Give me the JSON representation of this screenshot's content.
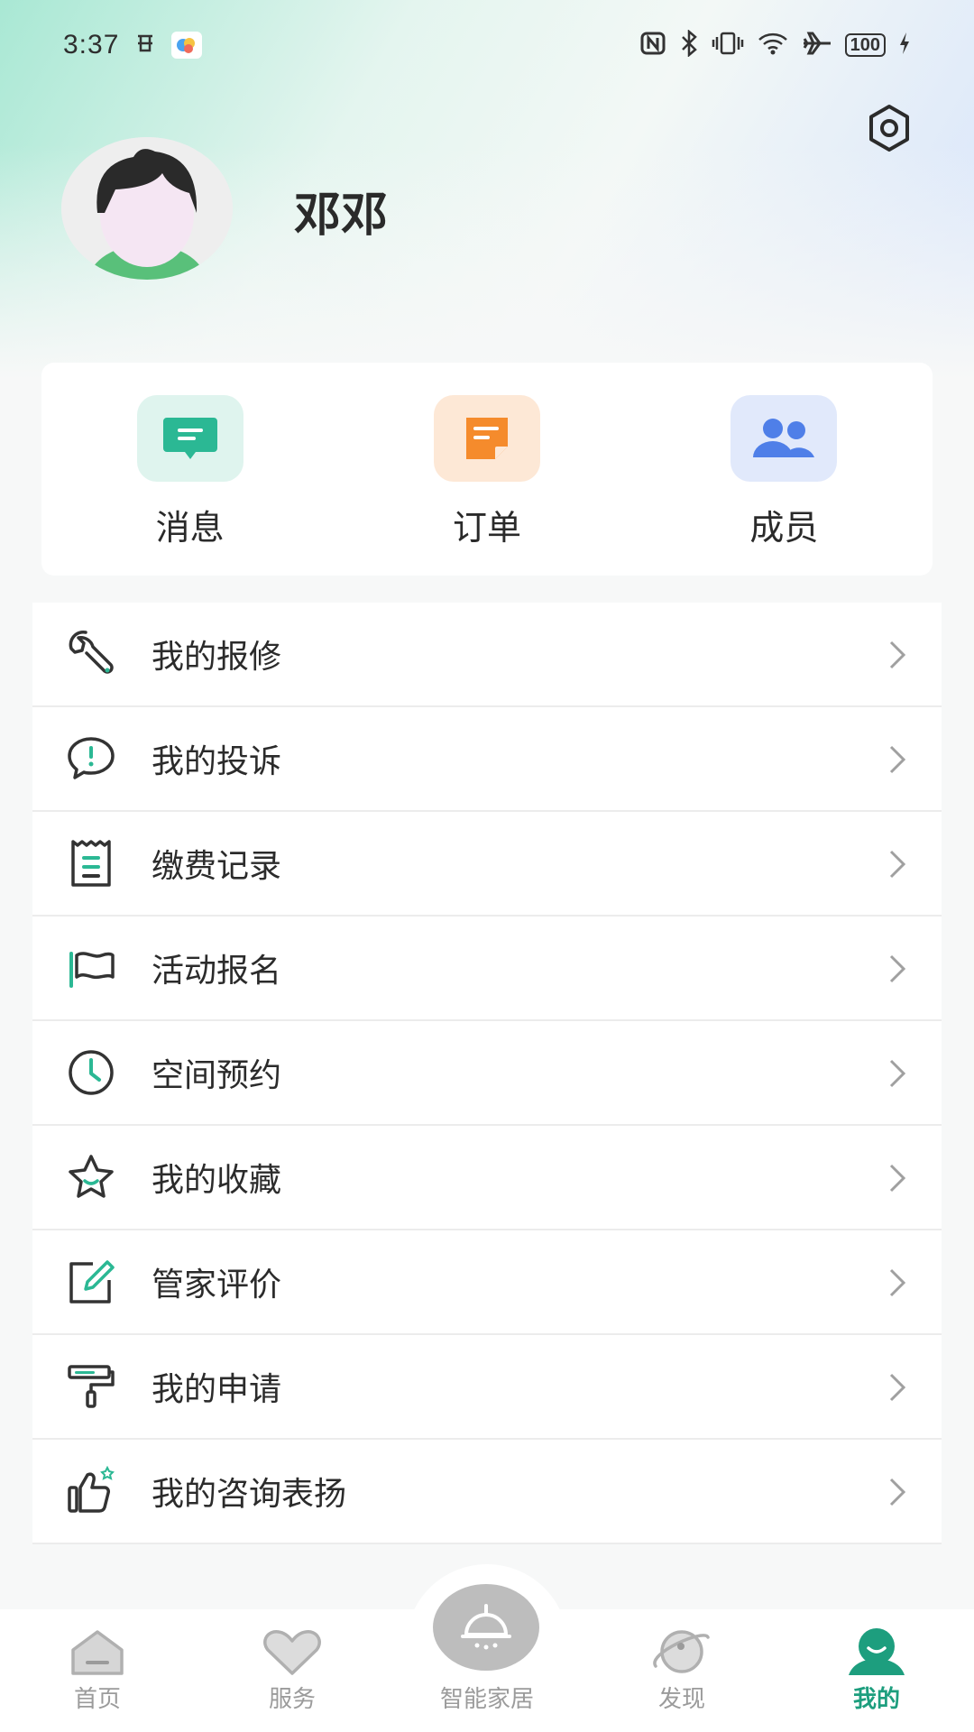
{
  "status_bar": {
    "time": "3:37",
    "battery": "100",
    "icons": [
      "nfc-icon",
      "bluetooth-icon",
      "vibrate-icon",
      "wifi-icon",
      "airplane-icon",
      "battery-icon",
      "charging-icon"
    ]
  },
  "profile": {
    "name": "邓邓",
    "settings_icon": "gear-icon"
  },
  "quick_actions": [
    {
      "label": "消息",
      "icon": "message-icon",
      "color": "#2bb894",
      "bg": "#dff4ee"
    },
    {
      "label": "订单",
      "icon": "order-icon",
      "color": "#f58b2c",
      "bg": "#fde8d6"
    },
    {
      "label": "成员",
      "icon": "members-icon",
      "color": "#4f7fe8",
      "bg": "#e1e9fb"
    }
  ],
  "menu": [
    {
      "label": "我的报修",
      "icon": "wrench-icon"
    },
    {
      "label": "我的投诉",
      "icon": "complaint-icon"
    },
    {
      "label": "缴费记录",
      "icon": "receipt-icon"
    },
    {
      "label": "活动报名",
      "icon": "flag-icon"
    },
    {
      "label": "空间预约",
      "icon": "clock-icon"
    },
    {
      "label": "我的收藏",
      "icon": "star-icon"
    },
    {
      "label": "管家评价",
      "icon": "edit-icon"
    },
    {
      "label": "我的申请",
      "icon": "roller-icon"
    },
    {
      "label": "我的咨询表扬",
      "icon": "thumbs-up-icon"
    }
  ],
  "tabs": [
    {
      "label": "首页",
      "icon": "home-icon",
      "active": false
    },
    {
      "label": "服务",
      "icon": "heart-icon",
      "active": false
    },
    {
      "label": "智能家居",
      "icon": "lamp-icon",
      "active": false
    },
    {
      "label": "发现",
      "icon": "planet-icon",
      "active": false
    },
    {
      "label": "我的",
      "icon": "profile-icon",
      "active": true
    }
  ],
  "colors": {
    "accent": "#1d9e7e",
    "icon_green": "#2bb894",
    "inactive": "#9b9b9b"
  }
}
